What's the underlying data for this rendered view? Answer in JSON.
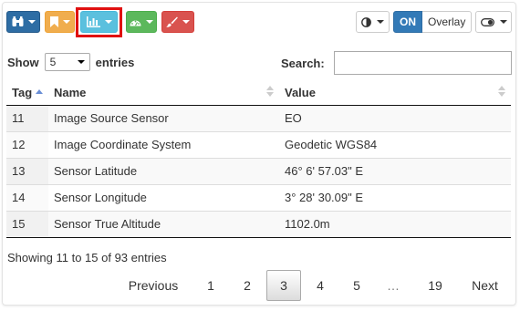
{
  "toolbar": {
    "buttons": [
      {
        "icon": "binoculars-icon",
        "color": "#2e6da4"
      },
      {
        "icon": "bookmark-icon",
        "color": "#f0ad4e"
      },
      {
        "icon": "bar-chart-icon",
        "color": "#5bc0de",
        "highlighted": true
      },
      {
        "icon": "dashboard-icon",
        "color": "#5cb85c"
      },
      {
        "icon": "paintbrush-icon",
        "color": "#d9534f"
      }
    ],
    "contrast_icon": "contrast-icon",
    "overlay_on": "ON",
    "overlay_label": "Overlay",
    "switch_icon": "toggle-switch-icon"
  },
  "length": {
    "prefix": "Show",
    "value": "5",
    "suffix": "entries"
  },
  "search": {
    "label": "Search:",
    "value": ""
  },
  "table": {
    "columns": [
      "Tag",
      "Name",
      "Value"
    ],
    "sorted_column": "Tag",
    "sort_direction": "ascending",
    "rows": [
      {
        "tag": "11",
        "name": "Image Source Sensor",
        "value": "EO"
      },
      {
        "tag": "12",
        "name": "Image Coordinate System",
        "value": "Geodetic WGS84"
      },
      {
        "tag": "13",
        "name": "Sensor Latitude",
        "value": "46° 6' 57.03\" E"
      },
      {
        "tag": "14",
        "name": "Sensor Longitude",
        "value": "3° 28' 30.09\" E"
      },
      {
        "tag": "15",
        "name": "Sensor True Altitude",
        "value": "1102.0m"
      }
    ]
  },
  "info": "Showing 11 to 15 of 93 entries",
  "pagination": {
    "previous": "Previous",
    "pages": [
      "1",
      "2",
      "3",
      "4",
      "5",
      "…",
      "19"
    ],
    "current": "3",
    "next": "Next"
  },
  "colors": {
    "highlight": "#e01010",
    "primary": "#337ab7"
  }
}
